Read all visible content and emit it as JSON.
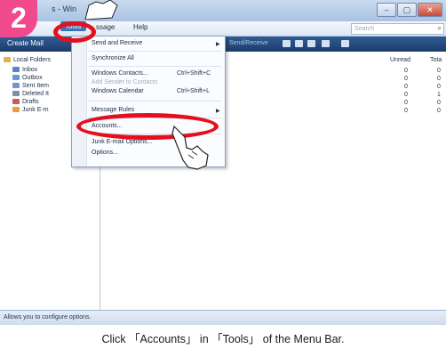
{
  "step_number": "2",
  "window": {
    "title": "s - Win",
    "controls": [
      "–",
      "▢",
      "✕"
    ]
  },
  "menubar": {
    "tools": "Tools",
    "message": "ssage",
    "help": "Help",
    "search_placeholder": "Search"
  },
  "toolbar": {
    "create_mail": "Create Mail",
    "send_receive": "Send/Receive"
  },
  "sidebar": {
    "root": "Local Folders",
    "folders": [
      "Inbox",
      "Outbox",
      "Sent Item",
      "Deleted It",
      "Drafts",
      "Junk E-m"
    ]
  },
  "columns": {
    "unread": "Unread",
    "total": "Tota"
  },
  "counts": {
    "unread": [
      "0",
      "0",
      "0",
      "0",
      "0",
      "0"
    ],
    "total": [
      "0",
      "0",
      "0",
      "1",
      "0",
      "0"
    ]
  },
  "tools_menu": {
    "items": [
      {
        "label": "Send and Receive",
        "shortcut": "",
        "submenu": true,
        "disabled": false
      },
      {
        "label": "Synchronize All",
        "shortcut": "",
        "submenu": false,
        "disabled": false
      },
      {
        "label": "Windows Contacts...",
        "shortcut": "Ctrl+Shift+C",
        "submenu": false,
        "disabled": false
      },
      {
        "label": "Add Sender to Contacts",
        "shortcut": "",
        "submenu": false,
        "disabled": true
      },
      {
        "label": "Windows Calendar",
        "shortcut": "Ctrl+Shift+L",
        "submenu": false,
        "disabled": false
      },
      {
        "label": "Message Rules",
        "shortcut": "",
        "submenu": true,
        "disabled": false
      },
      {
        "label": "Accounts...",
        "shortcut": "",
        "submenu": false,
        "disabled": false
      },
      {
        "label": "Junk E-mail Options...",
        "shortcut": "",
        "submenu": false,
        "disabled": false
      },
      {
        "label": "Options...",
        "shortcut": "",
        "submenu": false,
        "disabled": false
      }
    ]
  },
  "status_bar": "Allows you to configure options.",
  "caption": "Click 「Accounts」 in 「Tools」 of the Menu Bar.",
  "colors": {
    "highlight_ring": "#e4101e",
    "step_badge": "#f04a8c",
    "toolbar": "#1d3c68"
  }
}
